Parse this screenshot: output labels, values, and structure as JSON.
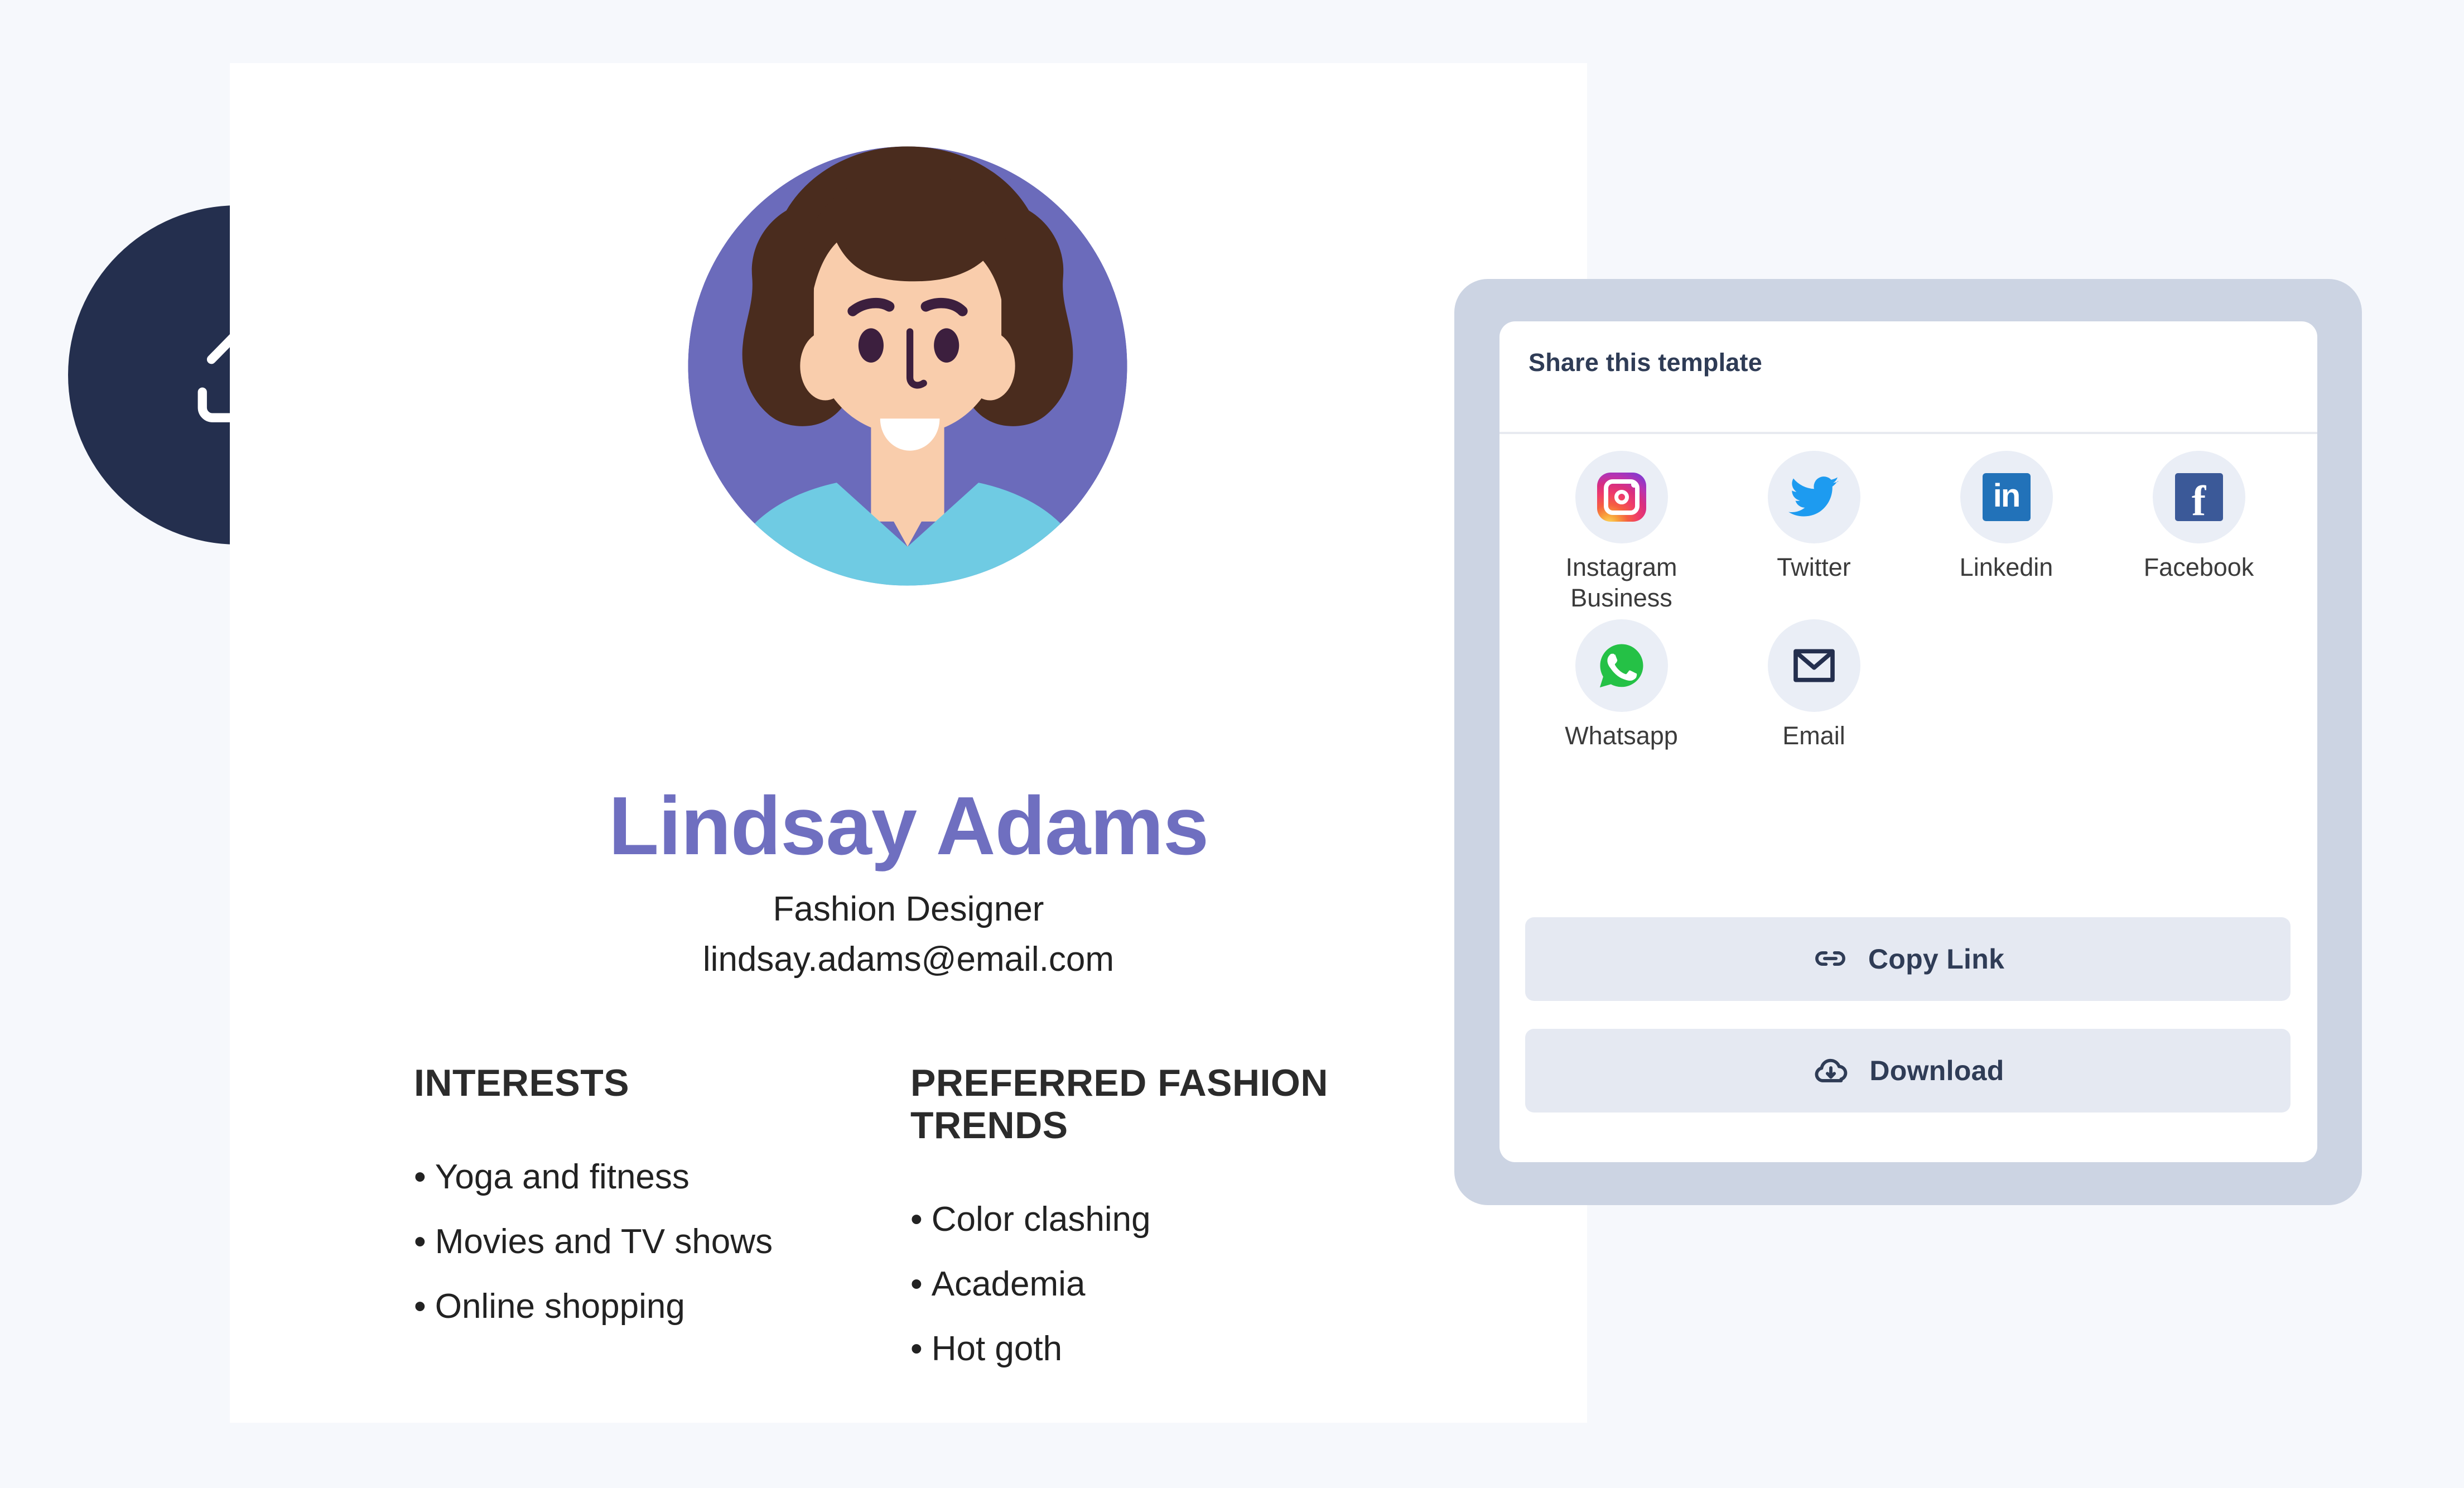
{
  "colors": {
    "page_background": "#f6f8fc",
    "card_background": "#ffffff",
    "upload_button": "#242f4e",
    "name_accent": "#6f6fc0",
    "panel_frame": "#ccd4e3",
    "action_button": "#e5e9f2",
    "action_text": "#2f3c56",
    "icon_circle": "#eaeef6",
    "avatar_background": "#6b6bbb",
    "avatar_hair": "#4a2c1e",
    "avatar_skin": "#f9cdac",
    "avatar_shirt": "#6fcbe3",
    "instagram": "#d92e7f",
    "twitter": "#1d9bf0",
    "linkedin": "#2272b9",
    "facebook": "#3b5998",
    "whatsapp": "#25c146",
    "email": "#242f4e"
  },
  "upload": {
    "icon": "upload-arrow-icon",
    "label": ""
  },
  "profile": {
    "avatar_icon": "woman-avatar-illustration",
    "name": "Lindsay Adams",
    "role": "Fashion Designer",
    "email": "lindsay.adams@email.com",
    "columns": [
      {
        "heading": "INTERESTS",
        "items": [
          "Yoga and fitness",
          "Movies and TV shows",
          "Online shopping"
        ]
      },
      {
        "heading": "PREFERRED FASHION TRENDS",
        "items": [
          "Color clashing",
          "Academia",
          "Hot goth"
        ]
      }
    ],
    "bullet": "•"
  },
  "share_panel": {
    "title": "Share this template",
    "targets": [
      {
        "label": "Instagram Business",
        "icon": "instagram-icon"
      },
      {
        "label": "Twitter",
        "icon": "twitter-icon"
      },
      {
        "label": "Linkedin",
        "icon": "linkedin-icon"
      },
      {
        "label": "Facebook",
        "icon": "facebook-icon"
      },
      {
        "label": "Whatsapp",
        "icon": "whatsapp-icon"
      },
      {
        "label": "Email",
        "icon": "email-icon"
      }
    ],
    "linkedin_glyph": "in",
    "facebook_glyph": "f",
    "actions": [
      {
        "label": "Copy Link",
        "icon": "link-icon"
      },
      {
        "label": "Download",
        "icon": "cloud-download-icon"
      }
    ]
  }
}
